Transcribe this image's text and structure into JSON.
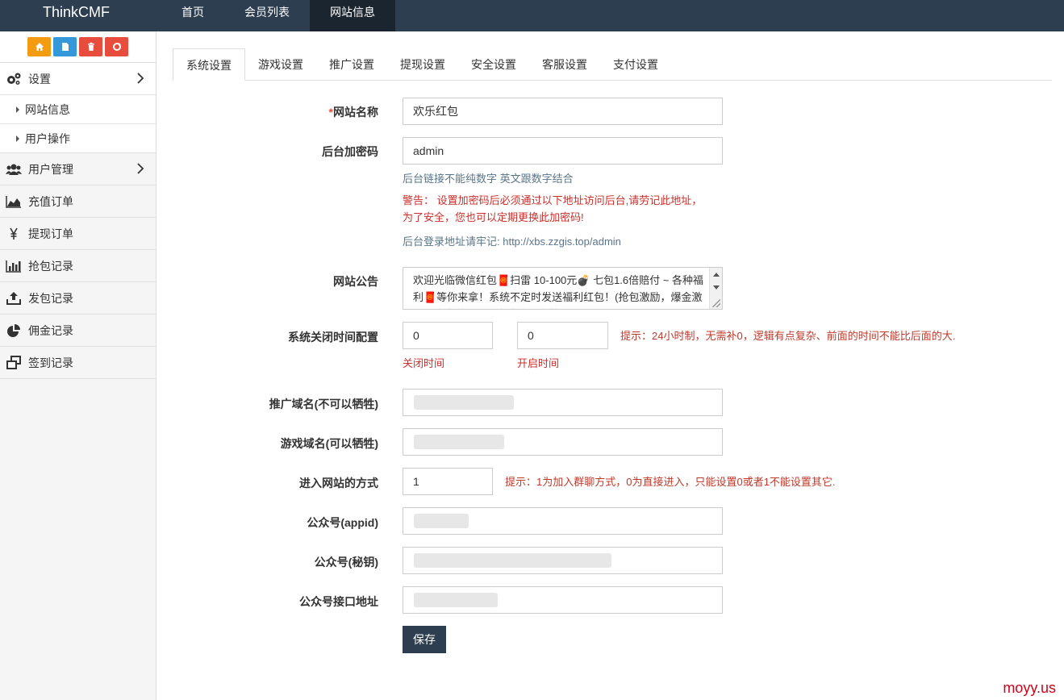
{
  "brand": "ThinkCMF",
  "topnav": [
    {
      "label": "首页",
      "active": false
    },
    {
      "label": "会员列表",
      "active": false
    },
    {
      "label": "网站信息",
      "active": true
    }
  ],
  "shortcuts": [
    {
      "icon": "home-icon",
      "color": "#f39c12"
    },
    {
      "icon": "file-icon",
      "color": "#3498db"
    },
    {
      "icon": "trash-icon",
      "color": "#e74c3c"
    },
    {
      "icon": "recycle-icon",
      "color": "#e74c3c"
    }
  ],
  "sidebar": {
    "settings": "设置",
    "sub": [
      "网站信息",
      "用户操作"
    ],
    "items": [
      "用户管理",
      "充值订单",
      "提现订单",
      "抢包记录",
      "发包记录",
      "佣金记录",
      "签到记录"
    ]
  },
  "tabs": [
    "系统设置",
    "游戏设置",
    "推广设置",
    "提现设置",
    "安全设置",
    "客服设置",
    "支付设置"
  ],
  "form": {
    "site_name_label": "网站名称",
    "site_name_value": "欢乐红包",
    "admin_code_label": "后台加密码",
    "admin_code_value": "admin",
    "admin_code_help": "后台链接不能纯数字 英文跟数字结合",
    "admin_code_warn": "警告：  设置加密码后必须通过以下地址访问后台,请劳记此地址，为了安全，您也可以定期更换此加密码!",
    "admin_url_text": "后台登录地址请牢记:   http://xbs.zzgis.top/admin",
    "notice_label": "网站公告",
    "notice_value": "欢迎光临微信红包🧧扫雷  10-100元💣 七包1.6倍赔付 ~ 各种福利🧧等你来拿！系统不定时发送福利红包！(抢包激励，爆金激励，土豪激励，均为官方利润的)",
    "close_time_label": "系统关闭时间配置",
    "close_time_value": "0",
    "open_time_value": "0",
    "close_time_sub": "关闭时间",
    "open_time_sub": "开启时间",
    "time_tip": "提示：24小时制，无需补0，逻辑有点复杂、前面的时间不能比后面的大.",
    "promo_domain_label": "推广域名(不可以牺牲)",
    "game_domain_label": "游戏域名(可以牺牲)",
    "enter_mode_label": "进入网站的方式",
    "enter_mode_value": "1",
    "enter_mode_tip": "提示：1为加入群聊方式，0为直接进入，只能设置0或者1不能设置其它.",
    "appid_label": "公众号(appid)",
    "secret_label": "公众号(秘钥)",
    "api_label": "公众号接口地址",
    "save_label": "保存"
  },
  "watermark": "moyy.us"
}
